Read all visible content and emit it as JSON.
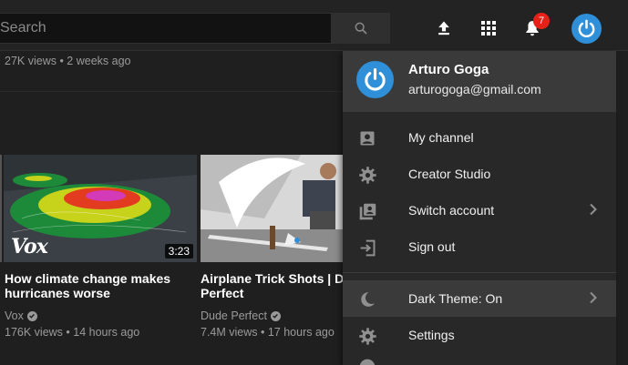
{
  "colors": {
    "accent": "#2f8fd8",
    "badge": "#e62117",
    "background": "#1f1f1f",
    "menu": "#282828"
  },
  "search": {
    "placeholder": "Search",
    "button_icon": "search-icon"
  },
  "topbar": {
    "upload_icon": "upload-icon",
    "apps_icon": "apps-grid-icon",
    "notifications_icon": "bell-icon",
    "notifications_count": "7",
    "account_icon": "power-avatar-icon"
  },
  "feed": {
    "previous_meta": "27K views • 2 weeks ago",
    "videos": [
      {
        "title_line1": "How climate change makes",
        "title_line2": "hurricanes worse",
        "channel": "Vox",
        "meta": "176K views • 14 hours ago",
        "duration": "3:23",
        "logo_text": "Vox"
      },
      {
        "title_line1": "Airplane Trick Shots | Dude",
        "title_line2": "Perfect",
        "channel": "Dude Perfect",
        "meta": "7.4M views • 17 hours ago"
      }
    ]
  },
  "account_menu": {
    "user_name": "Arturo Goga",
    "user_email": "arturogoga@gmail.com",
    "items": [
      {
        "label": "My channel",
        "icon": "account-box-icon"
      },
      {
        "label": "Creator Studio",
        "icon": "gear-icon"
      },
      {
        "label": "Switch account",
        "icon": "switch-account-icon",
        "has_submenu": true
      },
      {
        "label": "Sign out",
        "icon": "sign-out-icon"
      },
      {
        "label": "Dark Theme: On",
        "icon": "moon-icon",
        "has_submenu": true
      },
      {
        "label": "Settings",
        "icon": "gear-icon"
      }
    ]
  }
}
